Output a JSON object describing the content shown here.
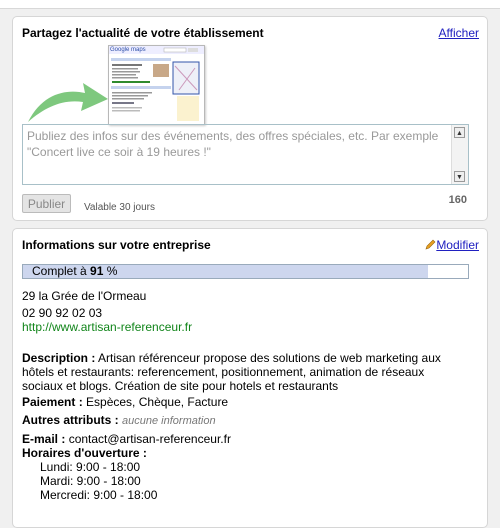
{
  "share": {
    "title": "Partagez l'actualité de votre établissement",
    "show_link": "Afficher",
    "thumb_logo": "Google maps",
    "placeholder": "Publiez des infos sur des événements, des offres spéciales, etc. Par exemple \"Concert live ce soir à 19 heures !\"",
    "publish_label": "Publier",
    "validity": "Valable 30 jours",
    "char_count": "160"
  },
  "business": {
    "title": "Informations sur votre entreprise",
    "edit_link": "Modifier",
    "progress_prefix": "Complet à",
    "progress_value": "91",
    "progress_suffix": "%",
    "progress_fraction": 0.91,
    "address": "29 la Grée de l'Ormeau",
    "phone": "02 90 92 02 03",
    "website": "http://www.artisan-referenceur.fr",
    "description_label": "Description :",
    "description": "Artisan référenceur propose des solutions de web marketing aux hôtels et restaurants: referencement, positionnement, animation de réseaux sociaux et blogs. Création de site pour hotels et restaurants",
    "payment_label": "Paiement :",
    "payment": "Espèces, Chèque, Facture",
    "other_label": "Autres attributs :",
    "other": "aucune information",
    "email_label": "E-mail :",
    "email": "contact@artisan-referenceur.fr",
    "hours_label": "Horaires d'ouverture :",
    "hours": [
      "Lundi: 9:00 - 18:00",
      "Mardi: 9:00 - 18:00",
      "Mercredi: 9:00 - 18:00"
    ]
  },
  "colors": {
    "link": "#2020c0",
    "website": "#11851a",
    "progress": "#cdd6ee",
    "arrow": "#7ec87e"
  }
}
